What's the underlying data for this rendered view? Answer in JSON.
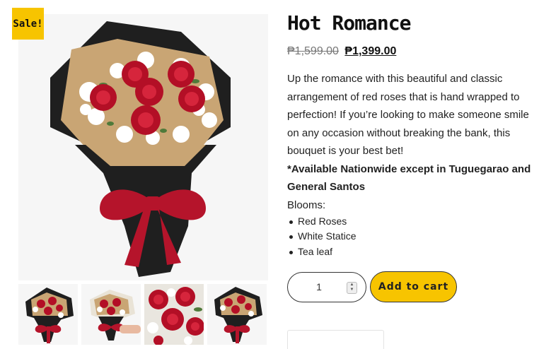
{
  "badge": {
    "label": "Sale!"
  },
  "product": {
    "title": "Hot Romance",
    "price_old": "₱1,599.00",
    "price_new": "₱1,399.00",
    "description": "Up the romance with this beautiful and classic arrangement of red roses that is hand wrapped to perfection! If you’re looking to make someone smile on any occasion without breaking the bank, this bouquet is your best bet!",
    "availability_note": "*Available Nationwide except in Tuguegarao and General Santos",
    "blooms_label": "Blooms:",
    "blooms": [
      "Red Roses",
      "White Statice",
      "Tea leaf"
    ]
  },
  "cart": {
    "quantity": "1",
    "add_label": "Add to cart"
  },
  "colors": {
    "accent": "#f7c400",
    "rose": "#c8102e",
    "wrap_dark": "#1f1f1f",
    "wrap_kraft": "#c9a574"
  },
  "icons": {
    "stepper": "number-stepper-arrows-icon"
  }
}
